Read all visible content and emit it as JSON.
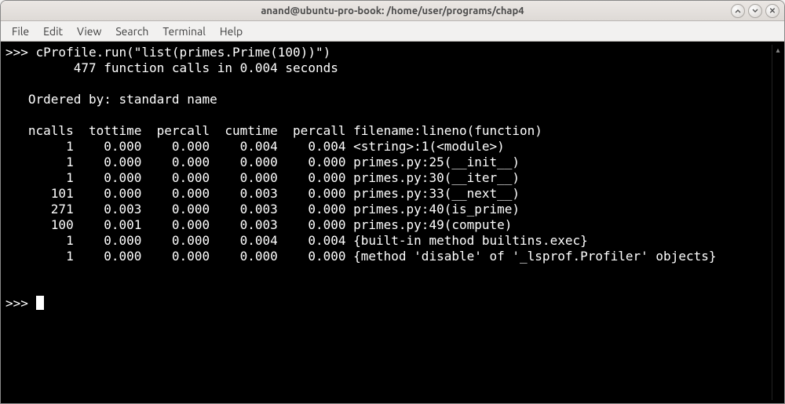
{
  "window": {
    "title": "anand@ubuntu-pro-book: /home/user/programs/chap4"
  },
  "window_controls": {
    "minimize_glyph": "",
    "maximize_glyph": "",
    "close_glyph": "✕"
  },
  "menubar": {
    "items": [
      "File",
      "Edit",
      "View",
      "Search",
      "Terminal",
      "Help"
    ]
  },
  "terminal": {
    "prompt": ">>>",
    "command": "cProfile.run(\"list(primes.Prime(100))\")",
    "summary_line": "         477 function calls in 0.004 seconds",
    "ordered_by": "   Ordered by: standard name",
    "header": {
      "ncalls": "ncalls",
      "tottime": "tottime",
      "percall1": "percall",
      "cumtime": "cumtime",
      "percall2": "percall",
      "filename": "filename:lineno(function)"
    },
    "rows": [
      {
        "ncalls": "1",
        "tottime": "0.000",
        "percall1": "0.000",
        "cumtime": "0.004",
        "percall2": "0.004",
        "fn": "<string>:1(<module>)"
      },
      {
        "ncalls": "1",
        "tottime": "0.000",
        "percall1": "0.000",
        "cumtime": "0.000",
        "percall2": "0.000",
        "fn": "primes.py:25(__init__)"
      },
      {
        "ncalls": "1",
        "tottime": "0.000",
        "percall1": "0.000",
        "cumtime": "0.000",
        "percall2": "0.000",
        "fn": "primes.py:30(__iter__)"
      },
      {
        "ncalls": "101",
        "tottime": "0.000",
        "percall1": "0.000",
        "cumtime": "0.003",
        "percall2": "0.000",
        "fn": "primes.py:33(__next__)"
      },
      {
        "ncalls": "271",
        "tottime": "0.003",
        "percall1": "0.000",
        "cumtime": "0.003",
        "percall2": "0.000",
        "fn": "primes.py:40(is_prime)"
      },
      {
        "ncalls": "100",
        "tottime": "0.001",
        "percall1": "0.000",
        "cumtime": "0.003",
        "percall2": "0.000",
        "fn": "primes.py:49(compute)"
      },
      {
        "ncalls": "1",
        "tottime": "0.000",
        "percall1": "0.000",
        "cumtime": "0.004",
        "percall2": "0.004",
        "fn": "{built-in method builtins.exec}"
      },
      {
        "ncalls": "1",
        "tottime": "0.000",
        "percall1": "0.000",
        "cumtime": "0.000",
        "percall2": "0.000",
        "fn": "{method 'disable' of '_lsprof.Profiler' objects}"
      }
    ],
    "final_prompt": ">>>"
  }
}
